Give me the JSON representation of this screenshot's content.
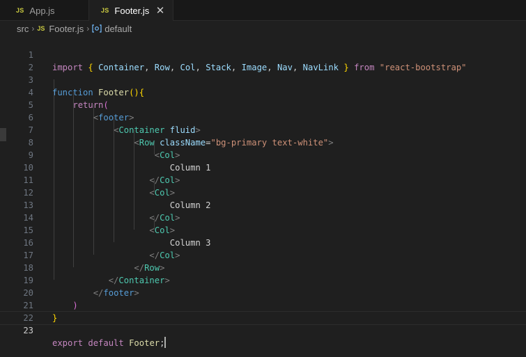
{
  "tabs": [
    {
      "icon": "JS",
      "label": "App.js"
    },
    {
      "icon": "JS",
      "label": "Footer.js"
    }
  ],
  "breadcrumb": {
    "folder": "src",
    "file_icon": "JS",
    "file": "Footer.js",
    "symbol": "default"
  },
  "code": {
    "l1": {
      "import": "import",
      "b1": "{",
      "mod1": "Container",
      "mod2": "Row",
      "mod3": "Col",
      "mod4": "Stack",
      "mod5": "Image",
      "mod6": "Nav",
      "mod7": "NavLink",
      "b2": "}",
      "from": "from",
      "source": "\"react-bootstrap\""
    },
    "l3": {
      "function": "function",
      "name": "Footer",
      "parens": "()",
      "brace": "{"
    },
    "l4": {
      "return": "return",
      "paren": "("
    },
    "l5": {
      "tag": "footer"
    },
    "l6": {
      "tag": "Container",
      "attr": "fluid"
    },
    "l7": {
      "tag": "Row",
      "attr": "className",
      "eq": "=",
      "value": "\"bg-primary text-white\""
    },
    "l8": {
      "tag": "Col"
    },
    "l9": {
      "text": "Column 1"
    },
    "l10": {
      "tag": "Col"
    },
    "l11": {
      "tag": "Col"
    },
    "l12": {
      "text": "Column 2"
    },
    "l13": {
      "tag": "Col"
    },
    "l14": {
      "tag": "Col"
    },
    "l15": {
      "text": "Column 3"
    },
    "l16": {
      "tag": "Col"
    },
    "l17": {
      "tag": "Row"
    },
    "l18": {
      "tag": "Container"
    },
    "l19": {
      "tag": "footer"
    },
    "l20": {
      "paren": ")"
    },
    "l21": {
      "brace": "}"
    },
    "l23": {
      "export": "export",
      "default": "default",
      "name": "Footer",
      "semi": ";"
    }
  },
  "line_numbers": [
    "1",
    "2",
    "3",
    "4",
    "5",
    "6",
    "7",
    "8",
    "9",
    "10",
    "11",
    "12",
    "13",
    "14",
    "15",
    "16",
    "17",
    "18",
    "19",
    "20",
    "21",
    "22",
    "23"
  ],
  "active_line": "23"
}
